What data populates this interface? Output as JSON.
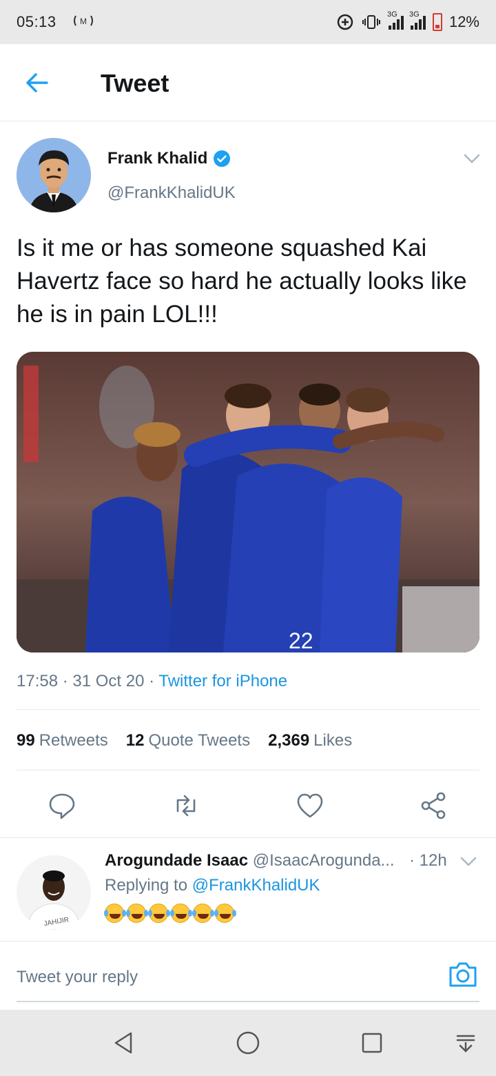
{
  "status_bar": {
    "time": "05:13",
    "network_1": "3G",
    "network_2": "3G",
    "battery": "12%",
    "battery_color": "#d23a2f"
  },
  "header": {
    "title": "Tweet",
    "back_icon": "arrow-left-icon"
  },
  "tweet": {
    "author_name": "Frank Khalid",
    "author_handle": "@FrankKhalidUK",
    "verified": true,
    "text": "Is it me or has someone squashed Kai Havertz face so hard he actually looks like he is in pain LOL!!!",
    "time": "17:58",
    "date": "31 Oct 20",
    "source": "Twitter for iPhone",
    "stats": {
      "retweets_count": "99",
      "retweets_label": "Retweets",
      "quotes_count": "12",
      "quotes_label": "Quote Tweets",
      "likes_count": "2,369",
      "likes_label": "Likes"
    },
    "actions": [
      "reply-icon",
      "retweet-icon",
      "like-icon",
      "share-icon"
    ]
  },
  "reply": {
    "name": "Arogundade Isaac",
    "handle": "@IsaacArogunda...",
    "time": "· 12h",
    "replying_prefix": "Replying to ",
    "replying_to": "@FrankKhalidUK",
    "emoji_count": 6,
    "emoji_icon": "rolling-on-floor-laughing-emoji"
  },
  "composer": {
    "placeholder": "Tweet your reply"
  },
  "colors": {
    "accent": "#1da1f2",
    "link": "#1b95e0",
    "muted": "#657786",
    "text": "#14171a"
  }
}
